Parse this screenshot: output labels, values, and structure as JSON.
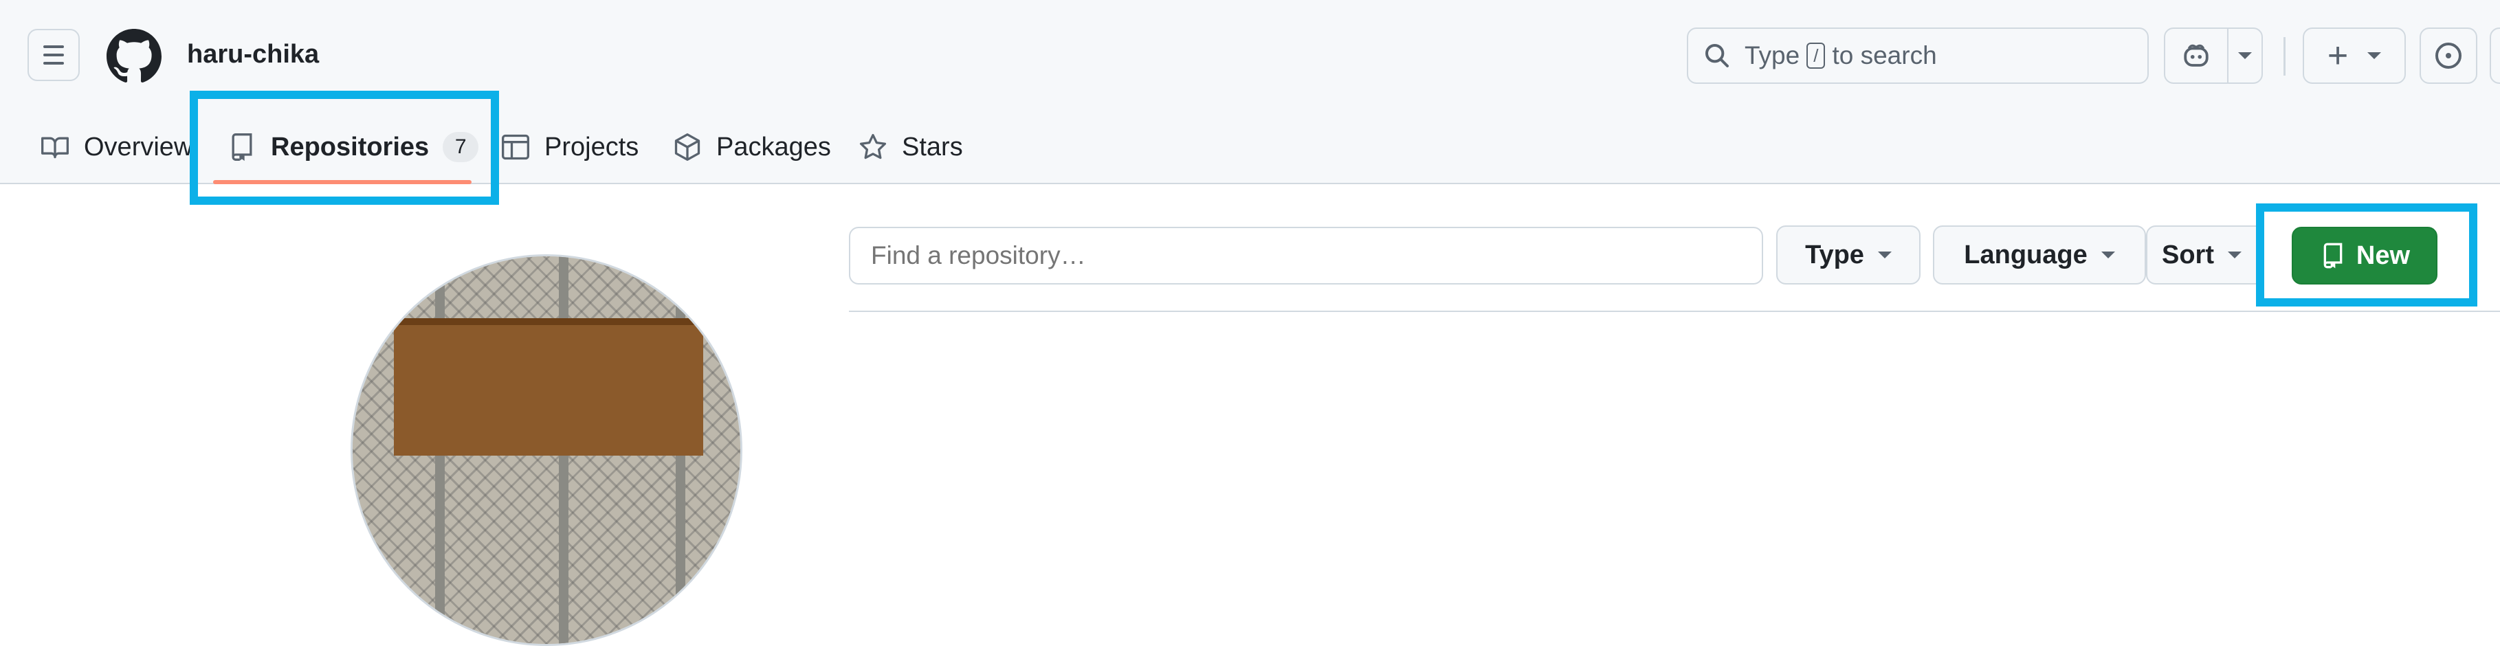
{
  "header": {
    "username": "haru-chika",
    "search": {
      "prefix": "Type",
      "key": "/",
      "suffix": "to search"
    }
  },
  "nav": {
    "tabs": [
      {
        "label": "Overview",
        "icon": "book-icon"
      },
      {
        "label": "Repositories",
        "icon": "repo-icon",
        "count": "7",
        "active": true
      },
      {
        "label": "Projects",
        "icon": "table-icon"
      },
      {
        "label": "Packages",
        "icon": "package-icon"
      },
      {
        "label": "Stars",
        "icon": "star-icon"
      }
    ]
  },
  "repos": {
    "filter_placeholder": "Find a repository…",
    "type_label": "Type",
    "language_label": "Language",
    "sort_label": "Sort",
    "new_label": "New"
  },
  "colors": {
    "highlight": "#0cb0e8",
    "new_button": "#1f883d",
    "tab_underline": "#fd8c73"
  }
}
